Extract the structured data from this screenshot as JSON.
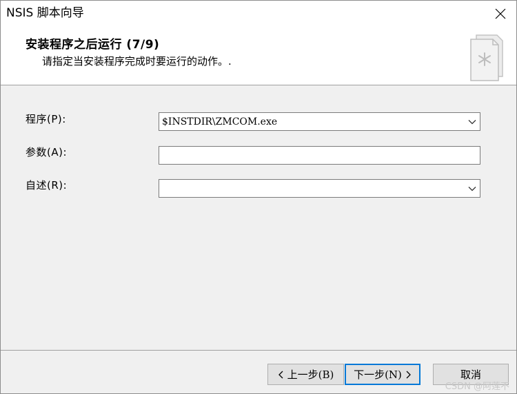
{
  "window": {
    "title": "NSIS 脚本向导"
  },
  "header": {
    "title": "安装程序之后运行 (7/9)",
    "subtitle": "请指定当安装程序完成时要运行的动作。."
  },
  "form": {
    "program": {
      "label": "程序(P):",
      "value": "$INSTDIR\\ZMCOM.exe"
    },
    "params": {
      "label": "参数(A):",
      "value": ""
    },
    "readme": {
      "label": "自述(R):",
      "value": ""
    }
  },
  "buttons": {
    "back": "上一步(B)",
    "next": "下一步(N)",
    "cancel": "取消"
  },
  "watermark": "CSDN @阿莲不",
  "icons": {
    "close": "close-icon",
    "wizard": "wizard-document-icon",
    "dropdown": "chevron-down-icon",
    "back": "chevron-left-icon",
    "next": "chevron-right-icon"
  },
  "colors": {
    "accent": "#0078d7",
    "window_bg": "#f0f0f0",
    "panel_bg": "#ffffff"
  }
}
